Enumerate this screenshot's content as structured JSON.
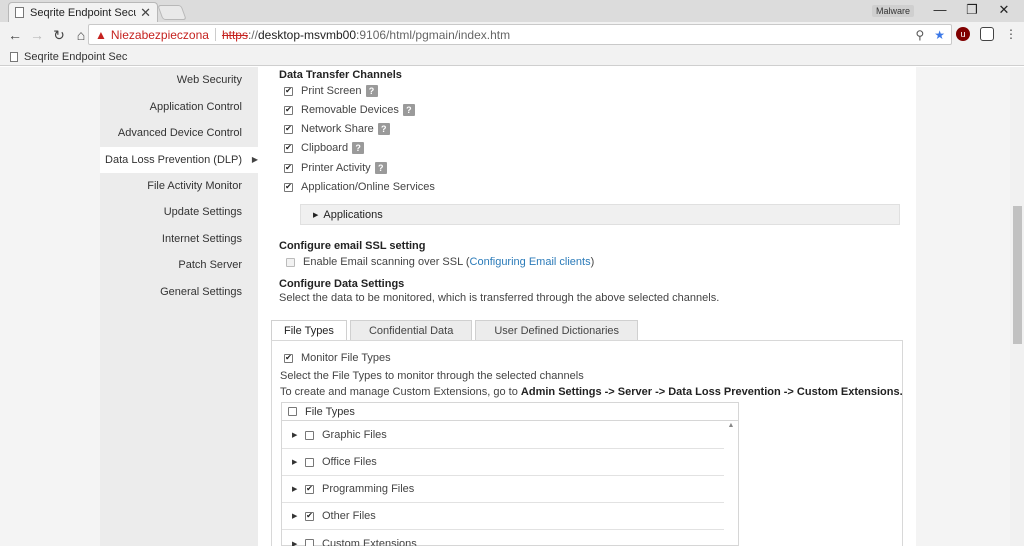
{
  "browser": {
    "tab_title": "Seqrite Endpoint Security",
    "tab_close": "✕",
    "profile_label": "Malware",
    "window_minimize": "—",
    "window_restore": "❐",
    "window_close": "✕",
    "security_label": "Niezabezpieczona",
    "url_protocol": "https",
    "url_sep": "://",
    "url_host": "desktop-msvmb00",
    "url_path": ":9106/html/pgmain/index.htm",
    "bookmark_label": "Seqrite Endpoint Sec"
  },
  "sidebar": {
    "items": [
      {
        "label": "Web Security"
      },
      {
        "label": "Application Control"
      },
      {
        "label": "Advanced Device Control"
      },
      {
        "label": "Data Loss Prevention (DLP)",
        "active": true
      },
      {
        "label": "File Activity Monitor"
      },
      {
        "label": "Update Settings"
      },
      {
        "label": "Internet Settings"
      },
      {
        "label": "Patch Server"
      },
      {
        "label": "General Settings"
      }
    ]
  },
  "transfer_channels": {
    "title": "Data Transfer Channels",
    "items": [
      {
        "label": "Print Screen",
        "checked": true,
        "help": "?"
      },
      {
        "label": "Removable Devices",
        "checked": true,
        "help": "?"
      },
      {
        "label": "Network Share",
        "checked": true,
        "help": "?"
      },
      {
        "label": "Clipboard",
        "checked": true,
        "help": "?"
      },
      {
        "label": "Printer Activity",
        "checked": true,
        "help": "?"
      },
      {
        "label": "Application/Online Services",
        "checked": true
      }
    ],
    "applications_label": "Applications"
  },
  "email_ssl": {
    "title": "Configure email SSL setting",
    "checkbox_label": "Enable Email scanning over SSL (",
    "link_label": "Configuring Email clients",
    "suffix": ")"
  },
  "data_settings": {
    "title": "Configure Data Settings",
    "description": "Select the data to be monitored, which is transferred through the above selected channels.",
    "tabs": [
      "File Types",
      "Confidential Data",
      "User Defined Dictionaries"
    ],
    "monitor_label": "Monitor File Types",
    "select_desc": "Select the File Types to monitor through the selected channels",
    "manage_prefix": "To create and manage Custom Extensions, go to ",
    "manage_path": "Admin Settings -> Server -> Data Loss Prevention -> Custom Extensions.",
    "file_types_header": "File Types",
    "file_types": [
      {
        "label": "Graphic Files",
        "checked": false
      },
      {
        "label": "Office Files",
        "checked": false
      },
      {
        "label": "Programming Files",
        "checked": true
      },
      {
        "label": "Other Files",
        "checked": true
      },
      {
        "label": "Custom Extensions",
        "checked": false
      }
    ]
  }
}
